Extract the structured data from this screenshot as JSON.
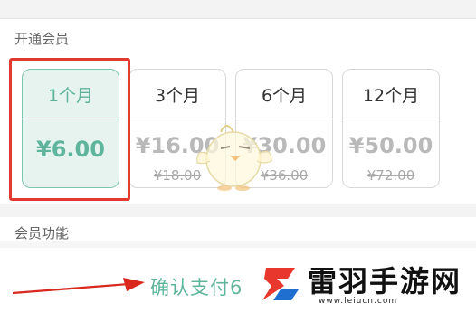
{
  "sections": {
    "open_membership": "开通会员",
    "member_features": "会员功能"
  },
  "plans": [
    {
      "duration": "1个月",
      "price": "¥6.00",
      "original": "",
      "selected": true
    },
    {
      "duration": "3个月",
      "price": "¥16.00",
      "original": "¥18.00",
      "selected": false
    },
    {
      "duration": "6个月",
      "price": "¥30.00",
      "original": "¥36.00",
      "selected": false
    },
    {
      "duration": "12个月",
      "price": "¥50.00",
      "original": "¥72.00",
      "selected": false
    }
  ],
  "confirm_button": "确认支付6",
  "watermark": {
    "name": "雷羽手游网",
    "url": "www.leiucn.com"
  },
  "colors": {
    "accent": "#5fb59c",
    "selected_bg": "#e6f3ef",
    "highlight": "#e23a2e",
    "arrow": "#d9281e"
  },
  "icons": {
    "mascot": "mascot-chick-icon",
    "watermark_logo": "leiyu-logo-icon",
    "arrow": "red-arrow-icon"
  }
}
